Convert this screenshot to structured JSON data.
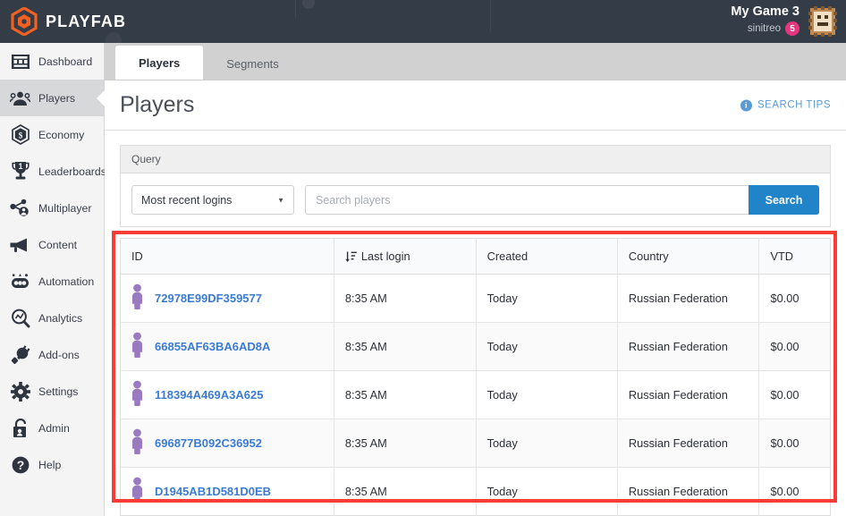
{
  "topbar": {
    "brand": "PLAYFAB",
    "brand_icon": "playfab-hexagon-logo",
    "game_title": "My Game 3",
    "studio": "sinitreo",
    "notification_count": "5",
    "avatar_icon": "pixel-game-avatar"
  },
  "sidebar": {
    "items": [
      {
        "label": "Dashboard",
        "icon": "dashboard-icon",
        "active": false
      },
      {
        "label": "Players",
        "icon": "players-icon",
        "active": true
      },
      {
        "label": "Economy",
        "icon": "economy-icon",
        "active": false
      },
      {
        "label": "Leaderboards",
        "icon": "leaderboards-icon",
        "active": false
      },
      {
        "label": "Multiplayer",
        "icon": "multiplayer-icon",
        "active": false
      },
      {
        "label": "Content",
        "icon": "content-icon",
        "active": false
      },
      {
        "label": "Automation",
        "icon": "automation-icon",
        "active": false
      },
      {
        "label": "Analytics",
        "icon": "analytics-icon",
        "active": false
      },
      {
        "label": "Add-ons",
        "icon": "addons-icon",
        "active": false
      },
      {
        "label": "Settings",
        "icon": "settings-icon",
        "active": false
      },
      {
        "label": "Admin",
        "icon": "admin-icon",
        "active": false
      },
      {
        "label": "Help",
        "icon": "help-icon",
        "active": false
      }
    ]
  },
  "tabs": [
    {
      "label": "Players",
      "active": true
    },
    {
      "label": "Segments",
      "active": false
    }
  ],
  "page": {
    "title": "Players",
    "search_tips_label": "SEARCH TIPS",
    "search_tips_icon": "info-icon"
  },
  "query": {
    "panel_title": "Query",
    "select_value": "Most recent logins",
    "select_caret_icon": "caret-down-icon",
    "search_placeholder": "Search players",
    "search_value": "",
    "search_button": "Search"
  },
  "table": {
    "sort_icon": "sort-descending-icon",
    "sort_column": "Last login",
    "row_avatar_icon": "player-avatar-icon",
    "columns": [
      "ID",
      "Last login",
      "Created",
      "Country",
      "VTD"
    ],
    "rows": [
      {
        "id": "72978E99DF359577",
        "last_login": "8:35 AM",
        "created": "Today",
        "country": "Russian Federation",
        "vtd": "$0.00"
      },
      {
        "id": "66855AF63BA6AD8A",
        "last_login": "8:35 AM",
        "created": "Today",
        "country": "Russian Federation",
        "vtd": "$0.00"
      },
      {
        "id": "118394A469A3A625",
        "last_login": "8:35 AM",
        "created": "Today",
        "country": "Russian Federation",
        "vtd": "$0.00"
      },
      {
        "id": "696877B092C36952",
        "last_login": "8:35 AM",
        "created": "Today",
        "country": "Russian Federation",
        "vtd": "$0.00"
      },
      {
        "id": "D1945AB1D581D0EB",
        "last_login": "8:35 AM",
        "created": "Today",
        "country": "Russian Federation",
        "vtd": "$0.00"
      }
    ]
  },
  "colors": {
    "topbar_bg": "#343c47",
    "brand_orange": "#f26122",
    "accent_blue": "#2284c8",
    "link_blue": "#3a7bd5",
    "badge_pink": "#e8357f",
    "highlight_red": "#fa3c36",
    "avatar_purple": "#9b7bc0"
  }
}
